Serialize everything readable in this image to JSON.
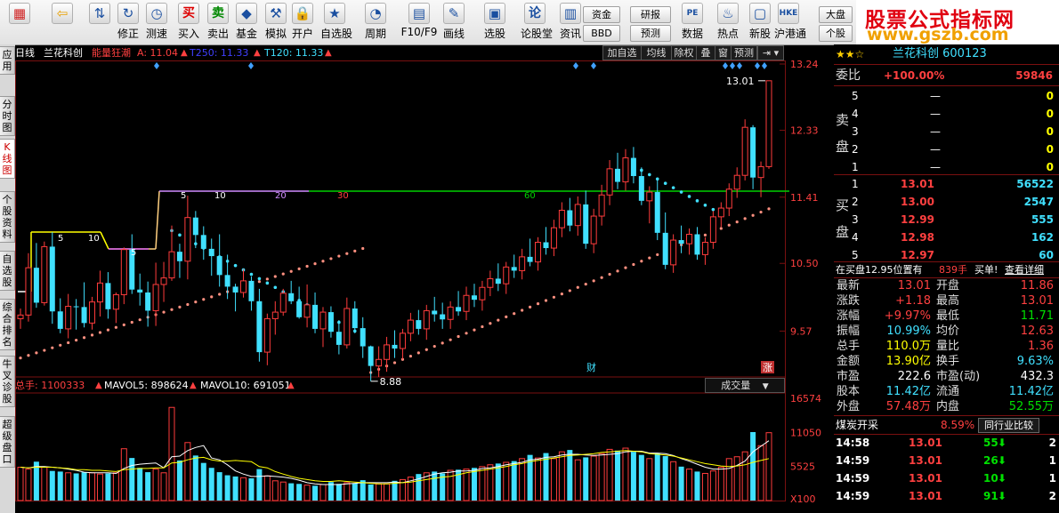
{
  "toolbar": {
    "buttons": [
      {
        "label": "",
        "icon": "windows-icon"
      },
      {
        "label": "",
        "icon": "back-arrow-icon"
      },
      {
        "label": "",
        "icon": "up-down-icon"
      },
      {
        "label": "修正",
        "icon": "refresh-icon"
      },
      {
        "label": "测速",
        "icon": "clock-icon"
      },
      {
        "label": "买入",
        "icon": "buy-icon",
        "glyph": "买"
      },
      {
        "label": "卖出",
        "icon": "sell-icon",
        "glyph": "卖"
      },
      {
        "label": "基金",
        "icon": "fund-icon"
      },
      {
        "label": "模拟",
        "icon": "hammer-icon"
      },
      {
        "label": "开户",
        "icon": "lock-icon"
      },
      {
        "label": "自选股",
        "icon": "star-icon"
      },
      {
        "label": "周期",
        "icon": "period-icon"
      },
      {
        "label": "F10/F9",
        "icon": "f10-icon"
      },
      {
        "label": "画线",
        "icon": "pen-icon"
      },
      {
        "label": "选股",
        "icon": "screen-icon"
      },
      {
        "label": "论股堂",
        "icon": "forum-icon",
        "glyph": "论"
      },
      {
        "label": "资讯",
        "icon": "news-icon"
      },
      {
        "label": "数据",
        "icon": "data-icon",
        "glyph": "PE"
      },
      {
        "label": "热点",
        "icon": "hot-icon"
      },
      {
        "label": "新股",
        "icon": "ipo-icon"
      },
      {
        "label": "沪港通",
        "icon": "hkex-icon",
        "glyph": "HKE"
      }
    ],
    "small_buttons": [
      "资金",
      "BBD",
      "研报",
      "预测",
      "大盘",
      "个股"
    ]
  },
  "logo": {
    "line1": "股票公式指标网",
    "line2": "www.gszb.com"
  },
  "left_tabs": [
    "应用",
    "分时图",
    "K线图",
    "个股资料",
    "自选股",
    "综合排名",
    "牛叉诊股",
    "超级盘口"
  ],
  "chart_header": {
    "period": "日线",
    "name": "兰花科创",
    "indicator": "能量狂潮",
    "a_label": "A: 11.04",
    "t250_label": "T250: 11.33",
    "t120_label": "T120: 11.33",
    "buttons": [
      "加自选",
      "均线",
      "除权",
      "叠",
      "窗",
      "预测"
    ]
  },
  "volume_header": {
    "total": "总手: 1100333",
    "mavol5": "MAVOL5: 898624",
    "mavol10": "MAVOL10: 691051",
    "selector": "成交量"
  },
  "chart_data": {
    "type": "candlestick",
    "y_ticks": [
      "13.24",
      "12.33",
      "11.41",
      "10.50",
      "9.57"
    ],
    "y_range": [
      9.0,
      13.24
    ],
    "vol_ticks": [
      "16574",
      "11050",
      "5525",
      "X100"
    ],
    "annotations": {
      "high": "13.01",
      "low": "8.88",
      "line_labels": [
        "5",
        "10",
        "5",
        "5",
        "10",
        "20",
        "30",
        "60"
      ],
      "events": [
        "财",
        "涨"
      ]
    },
    "candles": [
      [
        9.74,
        9.88,
        9.6,
        9.79
      ],
      [
        9.79,
        10.64,
        9.7,
        10.44
      ],
      [
        10.44,
        10.78,
        9.89,
        9.96
      ],
      [
        9.96,
        10.8,
        9.92,
        10.73
      ],
      [
        10.73,
        10.93,
        9.67,
        9.84
      ],
      [
        9.84,
        10.02,
        9.54,
        9.6
      ],
      [
        9.6,
        10.08,
        9.47,
        9.91
      ],
      [
        9.91,
        10.01,
        9.59,
        9.9
      ],
      [
        9.9,
        10.24,
        9.62,
        9.68
      ],
      [
        9.68,
        10.04,
        9.59,
        9.97
      ],
      [
        9.97,
        10.4,
        9.77,
        10.23
      ],
      [
        10.23,
        10.38,
        9.74,
        9.87
      ],
      [
        9.87,
        10.1,
        9.68,
        10.07
      ],
      [
        10.07,
        10.72,
        9.94,
        10.69
      ],
      [
        10.69,
        10.9,
        10.08,
        10.14
      ],
      [
        10.14,
        10.36,
        9.92,
        10.1
      ],
      [
        10.1,
        10.25,
        9.63,
        9.85
      ],
      [
        9.85,
        10.51,
        9.64,
        10.21
      ],
      [
        10.21,
        10.52,
        9.97,
        10.3
      ],
      [
        10.3,
        11.02,
        10.26,
        10.66
      ],
      [
        10.66,
        10.77,
        10.3,
        10.53
      ],
      [
        10.53,
        11.43,
        10.28,
        11.13
      ],
      [
        11.13,
        11.22,
        10.71,
        10.89
      ],
      [
        10.89,
        11.01,
        10.55,
        10.7
      ],
      [
        10.7,
        10.84,
        10.33,
        10.6
      ],
      [
        10.6,
        10.9,
        10.18,
        10.34
      ],
      [
        10.34,
        10.62,
        10.01,
        10.18
      ],
      [
        10.18,
        10.22,
        9.84,
        10.1
      ],
      [
        10.1,
        10.42,
        10.03,
        10.26
      ],
      [
        10.26,
        10.32,
        9.85,
        9.98
      ],
      [
        9.98,
        10.15,
        9.15,
        9.28
      ],
      [
        9.28,
        9.81,
        9.1,
        9.74
      ],
      [
        9.74,
        9.98,
        9.52,
        9.83
      ],
      [
        9.83,
        10.15,
        9.78,
        10.09
      ],
      [
        10.09,
        10.26,
        9.94,
        9.98
      ],
      [
        9.98,
        10.18,
        9.74,
        9.76
      ],
      [
        9.76,
        10.21,
        9.62,
        9.93
      ],
      [
        9.93,
        10.1,
        9.54,
        9.6
      ],
      [
        9.6,
        9.9,
        9.35,
        9.83
      ],
      [
        9.83,
        9.91,
        9.48,
        9.56
      ],
      [
        9.56,
        9.72,
        9.25,
        9.38
      ],
      [
        9.38,
        10.03,
        9.33,
        9.88
      ],
      [
        9.88,
        9.98,
        9.54,
        9.61
      ],
      [
        9.61,
        9.76,
        9.2,
        9.36
      ],
      [
        9.36,
        9.37,
        8.88,
        9.09
      ],
      [
        9.09,
        9.36,
        8.94,
        9.18
      ],
      [
        9.18,
        9.49,
        9.01,
        9.38
      ],
      [
        9.38,
        9.58,
        9.2,
        9.33
      ],
      [
        9.33,
        9.6,
        9.18,
        9.54
      ],
      [
        9.54,
        9.82,
        9.43,
        9.72
      ],
      [
        9.72,
        9.86,
        9.52,
        9.6
      ],
      [
        9.6,
        9.93,
        9.45,
        9.85
      ],
      [
        9.85,
        10.04,
        9.7,
        9.8
      ],
      [
        9.8,
        9.96,
        9.6,
        9.73
      ],
      [
        9.73,
        9.98,
        9.6,
        9.9
      ],
      [
        9.9,
        10.12,
        9.78,
        9.84
      ],
      [
        9.84,
        10.18,
        9.72,
        10.06
      ],
      [
        10.06,
        10.22,
        9.9,
        10.0
      ],
      [
        10.0,
        10.26,
        9.85,
        10.17
      ],
      [
        10.17,
        10.4,
        10.05,
        10.29
      ],
      [
        10.29,
        10.5,
        10.12,
        10.22
      ],
      [
        10.22,
        10.52,
        10.08,
        10.45
      ],
      [
        10.45,
        10.62,
        10.3,
        10.4
      ],
      [
        10.4,
        10.7,
        10.28,
        10.59
      ],
      [
        10.59,
        10.84,
        10.46,
        10.52
      ],
      [
        10.52,
        10.86,
        10.4,
        10.79
      ],
      [
        10.79,
        11.0,
        10.62,
        10.71
      ],
      [
        10.71,
        11.1,
        10.6,
        10.99
      ],
      [
        10.99,
        11.34,
        10.86,
        11.23
      ],
      [
        11.23,
        11.4,
        10.94,
        11.02
      ],
      [
        11.02,
        11.42,
        10.88,
        11.31
      ],
      [
        11.31,
        11.5,
        10.7,
        10.77
      ],
      [
        10.77,
        11.25,
        10.64,
        11.15
      ],
      [
        11.15,
        11.58,
        11.02,
        11.44
      ],
      [
        11.44,
        11.92,
        11.3,
        11.8
      ],
      [
        11.8,
        12.02,
        11.52,
        11.62
      ],
      [
        11.62,
        12.07,
        11.5,
        11.95
      ],
      [
        11.95,
        12.1,
        11.6,
        11.7
      ],
      [
        11.7,
        11.82,
        11.3,
        11.36
      ],
      [
        11.36,
        11.56,
        11.05,
        11.48
      ],
      [
        11.48,
        11.66,
        10.82,
        10.92
      ],
      [
        10.92,
        11.2,
        10.42,
        10.48
      ],
      [
        10.48,
        10.9,
        10.37,
        10.82
      ],
      [
        10.82,
        11.02,
        10.64,
        10.77
      ],
      [
        10.77,
        10.98,
        10.62,
        10.9
      ],
      [
        10.9,
        11.0,
        10.55,
        10.62
      ],
      [
        10.62,
        10.86,
        10.48,
        10.79
      ],
      [
        10.79,
        11.22,
        10.7,
        11.14
      ],
      [
        11.14,
        11.34,
        11.0,
        11.26
      ],
      [
        11.26,
        11.6,
        11.15,
        11.52
      ],
      [
        11.52,
        11.82,
        11.4,
        11.71
      ],
      [
        11.71,
        12.48,
        11.64,
        12.37
      ],
      [
        12.37,
        12.4,
        11.52,
        11.68
      ],
      [
        11.68,
        11.9,
        11.41,
        11.83
      ],
      [
        11.83,
        13.01,
        11.8,
        13.01
      ]
    ],
    "volumes": [
      5400,
      5100,
      6300,
      5400,
      4800,
      4700,
      4500,
      4400,
      4600,
      4500,
      4300,
      4400,
      4500,
      8400,
      6900,
      5300,
      4600,
      5100,
      4500,
      15100,
      6500,
      9400,
      7300,
      6100,
      5300,
      4600,
      4100,
      3900,
      3700,
      3600,
      5100,
      4000,
      3200,
      3000,
      2800,
      2700,
      2500,
      2400,
      2600,
      3000,
      2700,
      2900,
      2800,
      3300,
      2600,
      2700,
      2700,
      3200,
      3400,
      3800,
      4300,
      4500,
      4700,
      4400,
      4900,
      5000,
      5100,
      5300,
      5500,
      5800,
      6000,
      6200,
      6400,
      6800,
      7400,
      6900,
      7700,
      6800,
      7900,
      8200,
      6600,
      7000,
      7200,
      7600,
      8300,
      8100,
      8500,
      7900,
      7400,
      6800,
      7700,
      7200,
      6300,
      5500,
      5100,
      4700,
      4400,
      4800,
      5400,
      6800,
      7100,
      7900,
      11100,
      8900,
      11000
    ],
    "mavol5": [
      5400,
      5300,
      5500,
      5500,
      5400,
      5300,
      5100,
      4900,
      4600,
      4500,
      4500,
      4500,
      4400,
      5200,
      5700,
      5900,
      6000,
      6100,
      5300,
      7100,
      7200,
      8100,
      8600,
      8900,
      6900,
      6600,
      5800,
      4800,
      4300,
      3900,
      3900,
      4000,
      3900,
      3800,
      3600,
      3300,
      2900,
      2700,
      2600,
      2600,
      2600,
      2700,
      2800,
      2900,
      2900,
      2900,
      2900,
      3000,
      2900,
      3200,
      3500,
      3900,
      4300,
      4500,
      4600,
      4800,
      4800,
      4900,
      5200,
      5300,
      5500,
      5800,
      6000,
      6200,
      6600,
      6700,
      7000,
      7100,
      7400,
      7500,
      7500,
      7400,
      7300,
      7400,
      7500,
      7600,
      7900,
      8000,
      8000,
      7700,
      7700,
      7600,
      7300,
      6800,
      6400,
      5900,
      5400,
      5100,
      5100,
      5200,
      5700,
      6400,
      7900,
      8800,
      9700
    ],
    "mavol10": [
      5400,
      5300,
      5400,
      5400,
      5400,
      5300,
      5200,
      5000,
      5000,
      4900,
      4900,
      4800,
      4700,
      5000,
      5100,
      5200,
      5200,
      5300,
      5300,
      6100,
      6200,
      6600,
      6900,
      7000,
      6600,
      6400,
      6400,
      6500,
      6400,
      6300,
      5500,
      5300,
      4700,
      4300,
      3900,
      3600,
      3400,
      3200,
      3100,
      3100,
      3200,
      3100,
      3000,
      2900,
      2800,
      2700,
      2700,
      2800,
      2900,
      3000,
      3200,
      3400,
      3600,
      3800,
      3900,
      4200,
      4500,
      4700,
      4900,
      5100,
      5300,
      5500,
      5800,
      6000,
      6300,
      6500,
      6700,
      6900,
      7100,
      7300,
      7400,
      7500,
      7600,
      7800,
      7900,
      8000,
      8100,
      8000,
      7900,
      7600,
      7500,
      7400,
      7200,
      6900,
      6600,
      6300,
      6000,
      5800,
      5600,
      5500,
      5600,
      5800,
      6200,
      6500,
      6800
    ],
    "bull_dots_start": 9.2,
    "bear_dots_start": 10.95
  },
  "right_panel": {
    "title": "兰花科创 600123",
    "weibi": {
      "label": "委比",
      "pct": "+100.00%",
      "diff": "59846"
    },
    "sell_label": "卖盘",
    "buy_label": "买盘",
    "asks": [
      [
        "5",
        "—",
        "0"
      ],
      [
        "4",
        "—",
        "0"
      ],
      [
        "3",
        "—",
        "0"
      ],
      [
        "2",
        "—",
        "0"
      ],
      [
        "1",
        "—",
        "0"
      ]
    ],
    "bids": [
      [
        "1",
        "13.01",
        "56522"
      ],
      [
        "2",
        "13.00",
        "2547"
      ],
      [
        "3",
        "12.99",
        "555"
      ],
      [
        "4",
        "12.98",
        "162"
      ],
      [
        "5",
        "12.97",
        "60"
      ]
    ],
    "bid_note": {
      "text": "在买盘12.95位置有",
      "qty": "839手",
      "action": "买单!",
      "link": "查看详细"
    },
    "stats": [
      [
        "最新",
        "13.01",
        "开盘",
        "11.86",
        "red",
        "red"
      ],
      [
        "涨跌",
        "+1.18",
        "最高",
        "13.01",
        "red",
        "red"
      ],
      [
        "涨幅",
        "+9.97%",
        "最低",
        "11.71",
        "red",
        "green"
      ],
      [
        "振幅",
        "10.99%",
        "均价",
        "12.63",
        "cyan",
        "red"
      ],
      [
        "总手",
        "110.0万",
        "量比",
        "1.36",
        "yellow",
        "red"
      ],
      [
        "金额",
        "13.90亿",
        "换手",
        "9.63%",
        "yellow",
        "cyan"
      ],
      [
        "市盈",
        "222.6",
        "市盈(动)",
        "432.3",
        "white",
        "white"
      ],
      [
        "股本",
        "11.42亿",
        "流通",
        "11.42亿",
        "cyan",
        "cyan"
      ],
      [
        "外盘",
        "57.48万",
        "内盘",
        "52.55万",
        "red",
        "green"
      ]
    ],
    "sector": {
      "name": "煤炭开采",
      "pct": "8.59%",
      "compare": "同行业比较"
    },
    "ticks": [
      [
        "14:58",
        "13.01",
        "55",
        "2"
      ],
      [
        "14:59",
        "13.01",
        "26",
        "1"
      ],
      [
        "14:59",
        "13.01",
        "10",
        "1"
      ],
      [
        "14:59",
        "13.01",
        "91",
        "2"
      ]
    ]
  },
  "colors": {
    "up": "#ff3c3c",
    "down": "#40e0ff",
    "bg": "#000000",
    "grid": "#7a1010"
  }
}
